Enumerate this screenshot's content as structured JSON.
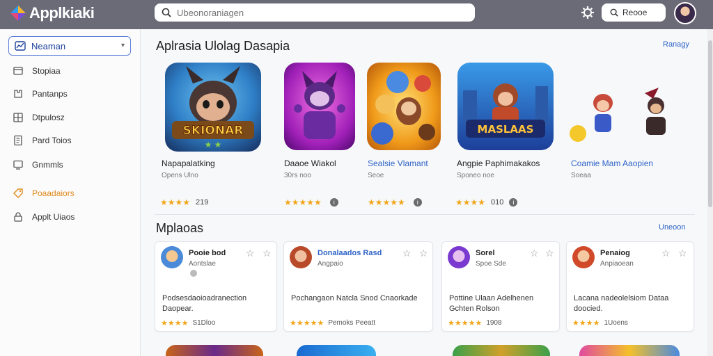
{
  "app": {
    "title": "Applkiaki"
  },
  "search": {
    "placeholder": "Ubeonoraniagen"
  },
  "header": {
    "search_button": "Reooe"
  },
  "sidebar": {
    "select_value": "Neaman",
    "items": [
      {
        "label": "Stopiaa",
        "icon": "home-icon"
      },
      {
        "label": "Pantanps",
        "icon": "puzzle-icon"
      },
      {
        "label": "Dtpulosz",
        "icon": "grid-icon"
      },
      {
        "label": "Pard Toios",
        "icon": "document-icon"
      },
      {
        "label": "Gnmmls",
        "icon": "monitor-icon"
      },
      {
        "label": "Poaadaiors",
        "icon": "tag-icon"
      },
      {
        "label": "Applt Uiaos",
        "icon": "lock-icon"
      }
    ]
  },
  "featured": {
    "title": "Aplrasia Ulolag Dasapia",
    "link": "Ranagy",
    "icon_text": "SKIONAR",
    "apps": [
      {
        "name": "Napapalatking",
        "sub": "Opens Ulno",
        "rating": "219"
      },
      {
        "name": "Daaoe Wiakol",
        "sub": "30rs noo",
        "rating": ""
      },
      {
        "name": "Sealsie Vlamant",
        "sub": "Seoe",
        "rating": ""
      },
      {
        "name": "Angpie Paphimakakos",
        "sub": "Sponeo noe",
        "rating": "010"
      },
      {
        "name": "Coamie Mam Aaopien",
        "sub": "Soeaa",
        "rating": ""
      }
    ]
  },
  "more": {
    "title": "Mplaoas",
    "link": "Uneoon",
    "cards": [
      {
        "title": "Pooie bod",
        "sub": "Aontslae",
        "desc": "Podsesdaoioadranection Daopear.",
        "rating": "S1Dloo"
      },
      {
        "title": "Donalaados Rasd",
        "sub": "Angpaio",
        "desc": "Pochangaon Natcla Snod Cnaorkade",
        "rating": "Pemoks Peeatt"
      },
      {
        "title": "Sorel",
        "sub": "Spoe Sde",
        "desc": "Pottine Ulaan Adelhenen Gchten Rolson",
        "rating": "1908"
      },
      {
        "title": "Penaiog",
        "sub": "Anpiaoean",
        "desc": "Lacana nadeolelsiom Dataa doocied.",
        "rating": "1Uoens"
      }
    ]
  }
}
